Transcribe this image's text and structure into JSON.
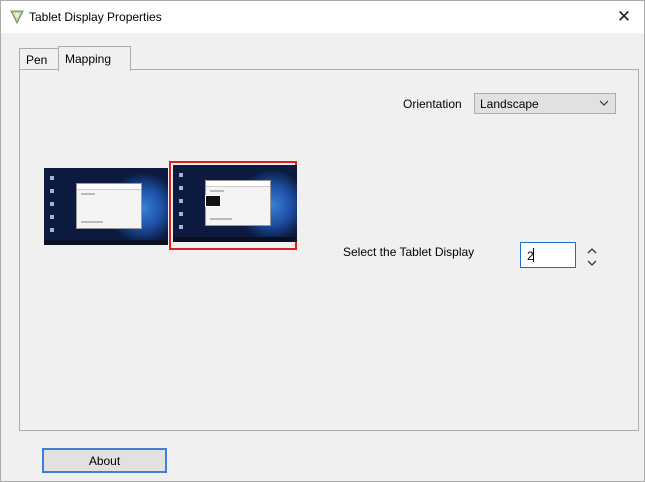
{
  "window": {
    "title": "Tablet Display Properties",
    "close_label": "✕",
    "icon": "tablet-app-icon"
  },
  "tabs": [
    {
      "label": "Pen",
      "selected": false
    },
    {
      "label": "Mapping",
      "selected": true
    }
  ],
  "mapping": {
    "orientation_label": "Orientation",
    "orientation_value": "Landscape",
    "select_display_label": "Select the Tablet Display",
    "display_value": "2",
    "spinner_up": "˄",
    "spinner_down": "˅",
    "selected_monitor_color": "#e02020"
  },
  "footer": {
    "about_label": "About"
  },
  "colors": {
    "focus_accent": "#3c7fd9"
  }
}
